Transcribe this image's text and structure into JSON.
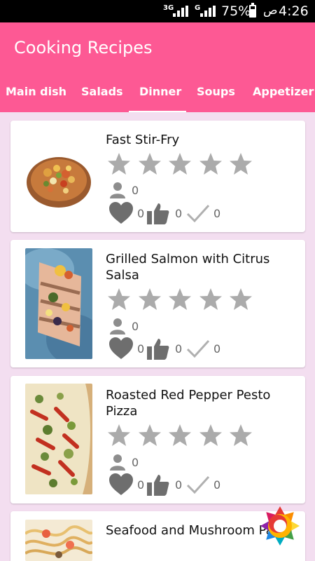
{
  "status_bar": {
    "network_1": "3G",
    "network_2": "G",
    "battery": "75%",
    "am_pm": "ص",
    "time": "4:26"
  },
  "app": {
    "title": "Cooking Recipes",
    "tabs": [
      {
        "label": "Main dish",
        "selected": false
      },
      {
        "label": "Salads",
        "selected": false
      },
      {
        "label": "Dinner",
        "selected": true
      },
      {
        "label": "Soups",
        "selected": false
      },
      {
        "label": "Appetizer",
        "selected": false
      }
    ],
    "accent_color": "#fd5994",
    "background_color": "#f3def0"
  },
  "recipes": [
    {
      "title": "Fast Stir-Fry",
      "rating": 0,
      "reviewers": "0",
      "likes": "0",
      "thumbs_up": "0",
      "checks": "0",
      "image": "stir-fry-photo"
    },
    {
      "title": "Grilled Salmon with Citrus Salsa",
      "rating": 0,
      "reviewers": "0",
      "likes": "0",
      "thumbs_up": "0",
      "checks": "0",
      "image": "grilled-salmon-photo"
    },
    {
      "title": "Roasted Red Pepper Pesto Pizza",
      "rating": 0,
      "reviewers": "0",
      "likes": "0",
      "thumbs_up": "0",
      "checks": "0",
      "image": "pesto-pizza-photo"
    },
    {
      "title": "Seafood and Mushroom Pasta",
      "image": "seafood-pasta-photo"
    }
  ],
  "fab": {
    "icon": "colorful-gear-icon"
  }
}
